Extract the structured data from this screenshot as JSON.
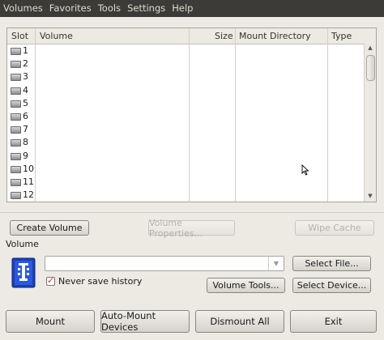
{
  "menu": [
    "Volumes",
    "Favorites",
    "Tools",
    "Settings",
    "Help"
  ],
  "table": {
    "headers": {
      "slot": "Slot",
      "volume": "Volume",
      "size": "Size",
      "mount": "Mount Directory",
      "type": "Type"
    },
    "rows": [
      "1",
      "2",
      "3",
      "4",
      "5",
      "6",
      "7",
      "8",
      "9",
      "10",
      "11",
      "12"
    ]
  },
  "buttons": {
    "create_volume": "Create Volume",
    "volume_properties": "Volume Properties...",
    "wipe_cache": "Wipe Cache",
    "select_file": "Select File...",
    "volume_tools": "Volume Tools...",
    "select_device": "Select Device...",
    "mount": "Mount",
    "auto_mount": "Auto-Mount Devices",
    "dismount_all": "Dismount All",
    "exit": "Exit"
  },
  "volume_section": {
    "label": "Volume",
    "path_value": "",
    "never_save_history": "Never save history",
    "never_save_checked": true
  },
  "colors": {
    "menubar_bg": "#3c3b37",
    "window_bg": "#ede9e3",
    "check_mark": "#c0392b"
  }
}
